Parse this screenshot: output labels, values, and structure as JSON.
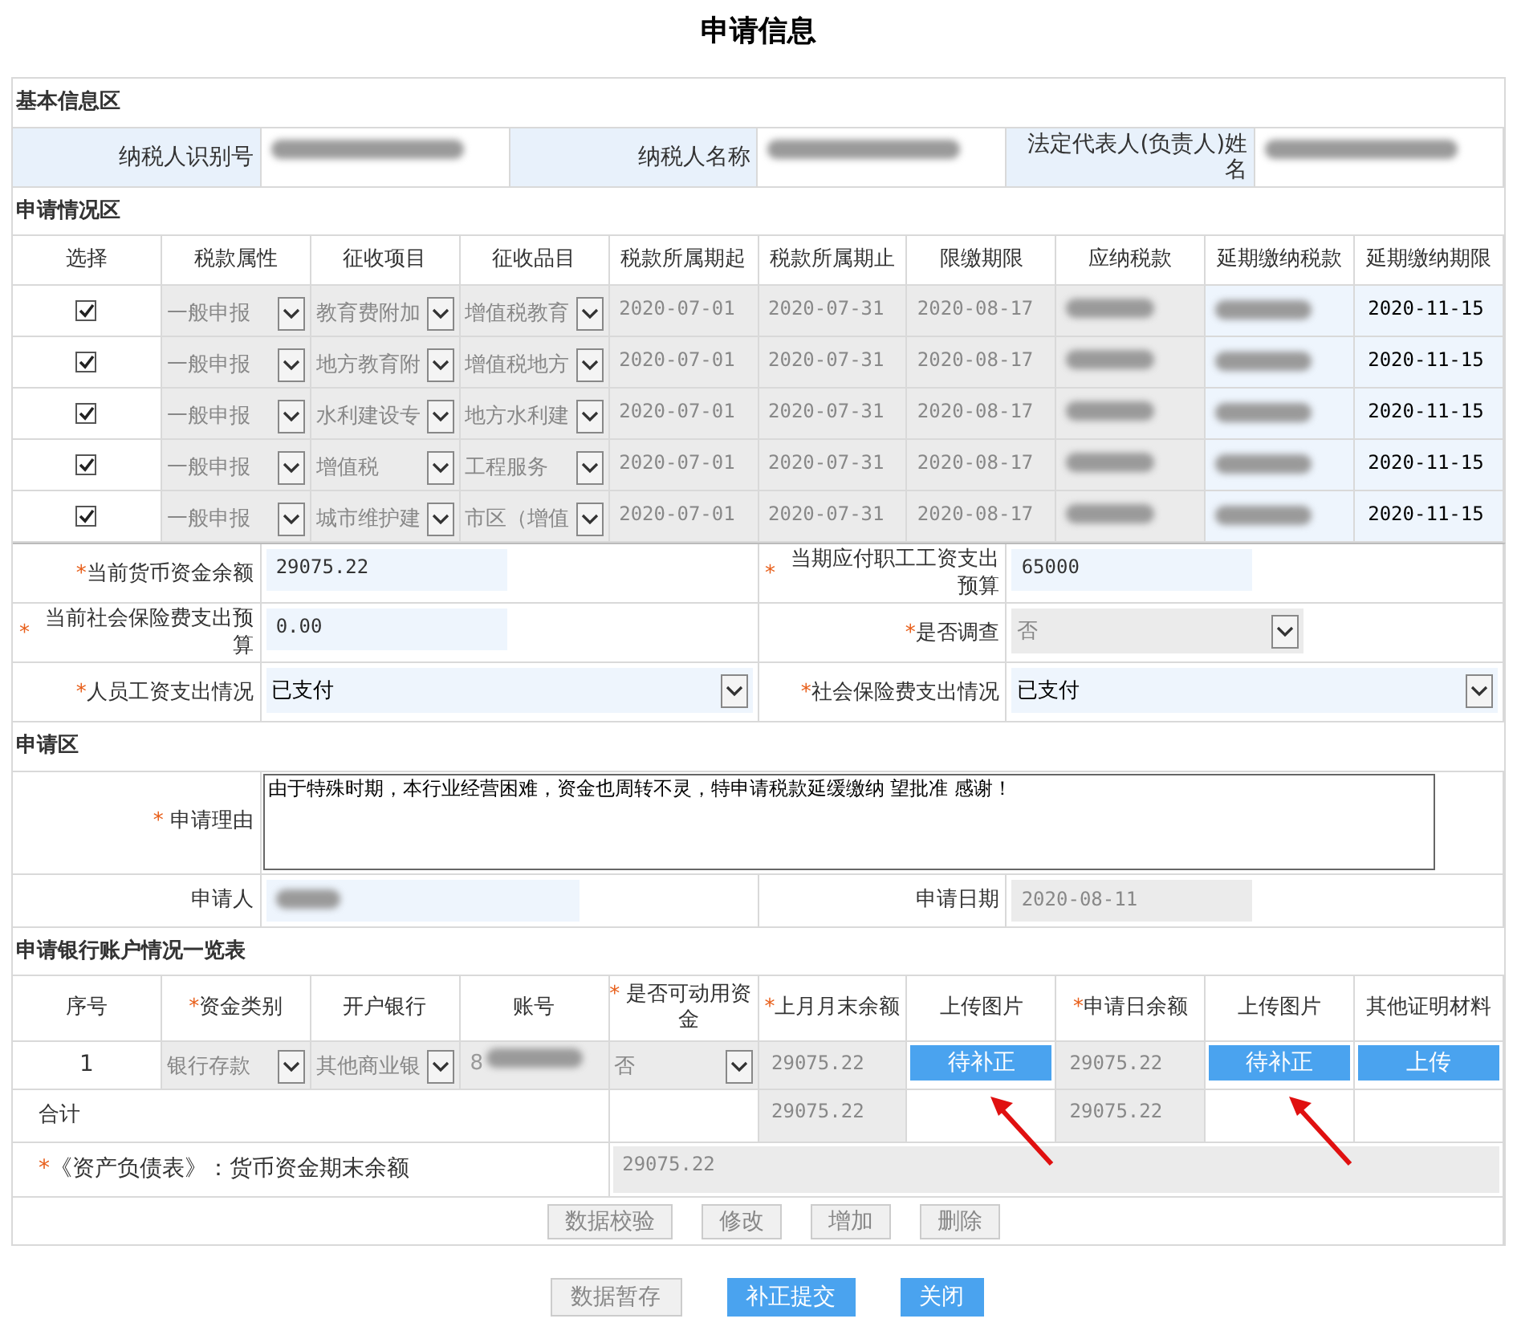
{
  "title": "申请信息",
  "basic_info": {
    "section_title": "基本信息区",
    "fields": [
      {
        "label": "纳税人识别号",
        "redacted": true
      },
      {
        "label": "纳税人名称",
        "redacted": true
      },
      {
        "label": "法定代表人(负责人)姓名",
        "redacted": true
      }
    ]
  },
  "application": {
    "section_title": "申请情况区",
    "columns": [
      "选择",
      "税款属性",
      "征收项目",
      "征收品目",
      "税款所属期起",
      "税款所属期止",
      "限缴期限",
      "应纳税款",
      "延期缴纳税款",
      "延期缴纳期限"
    ],
    "rows": [
      {
        "checked": true,
        "tax_attribute": "一般申报",
        "item": "教育费附加",
        "subitem": "增值税教育",
        "period_start": "2020-07-01",
        "period_end": "2020-07-31",
        "deadline": "2020-08-17",
        "tax_due_redacted": true,
        "deferred_tax_redacted": true,
        "deferred_deadline": "2020-11-15"
      },
      {
        "checked": true,
        "tax_attribute": "一般申报",
        "item": "地方教育附",
        "subitem": "增值税地方",
        "period_start": "2020-07-01",
        "period_end": "2020-07-31",
        "deadline": "2020-08-17",
        "tax_due_redacted": true,
        "deferred_tax_redacted": true,
        "deferred_deadline": "2020-11-15"
      },
      {
        "checked": true,
        "tax_attribute": "一般申报",
        "item": "水利建设专",
        "subitem": "地方水利建",
        "period_start": "2020-07-01",
        "period_end": "2020-07-31",
        "deadline": "2020-08-17",
        "tax_due_redacted": true,
        "deferred_tax_redacted": true,
        "deferred_deadline": "2020-11-15"
      },
      {
        "checked": true,
        "tax_attribute": "一般申报",
        "item": "增值税",
        "subitem": "工程服务",
        "period_start": "2020-07-01",
        "period_end": "2020-07-31",
        "deadline": "2020-08-17",
        "tax_due_redacted": true,
        "deferred_tax_redacted": true,
        "deferred_deadline": "2020-11-15"
      },
      {
        "checked": true,
        "tax_attribute": "一般申报",
        "item": "城市维护建",
        "subitem": "市区（增值",
        "period_start": "2020-07-01",
        "period_end": "2020-07-31",
        "deadline": "2020-08-17",
        "tax_due_redacted": true,
        "deferred_tax_redacted": true,
        "deferred_deadline": "2020-11-15"
      }
    ]
  },
  "finance_fields": [
    {
      "label": "当前货币资金余额",
      "required_mark": "*",
      "kind": "input",
      "value": "29075.22",
      "disabled": false
    },
    {
      "label": "当期应付职工工资支出预算",
      "required_mark": "*",
      "kind": "input",
      "value": "65000",
      "disabled": false
    },
    {
      "label": "当前社会保险费支出预算",
      "required_mark": "*",
      "kind": "input",
      "value": "0.00",
      "disabled": false
    },
    {
      "label": "是否调查",
      "required_mark": "*",
      "kind": "select",
      "value": "否",
      "disabled": true
    },
    {
      "label": "人员工资支出情况",
      "required_mark": "*",
      "kind": "select",
      "value": "已支付",
      "disabled": false
    },
    {
      "label": "社会保险费支出情况",
      "required_mark": "*",
      "kind": "select",
      "value": "已支付",
      "disabled": false
    }
  ],
  "request": {
    "section_title": "申请区",
    "reason_required_mark": "*",
    "reason_label": "申请理由",
    "reason": "由于特殊时期，本行业经营困难，资金也周转不灵，特申请税款延缓缴纳 望批准 感谢！",
    "applicant_label": "申请人",
    "applicant_redacted": true,
    "date_label": "申请日期",
    "date": "2020-08-11"
  },
  "bank": {
    "section_title": "申请银行账户情况一览表",
    "columns": [
      {
        "label": "序号"
      },
      {
        "label": "资金类别",
        "required_mark": "*"
      },
      {
        "label": "开户银行"
      },
      {
        "label": "账号"
      },
      {
        "label": "是否可动用资金",
        "required_mark": "*"
      },
      {
        "label": "上月月末余额",
        "required_mark": "*"
      },
      {
        "label": "上传图片"
      },
      {
        "label": "申请日余额",
        "required_mark": "*"
      },
      {
        "label": "上传图片"
      },
      {
        "label": "其他证明材料"
      }
    ],
    "rows": [
      {
        "index": "1",
        "fund_type": "银行存款",
        "bank": "其他商业银",
        "account_visible": "8",
        "usable": "否",
        "prev_balance": "29075.22",
        "upload_1": {
          "label": "待补正",
          "pointed": true
        },
        "day_balance": "29075.22",
        "upload_2": {
          "label": "待补正",
          "pointed": true
        },
        "other": {
          "label": "上传"
        }
      }
    ],
    "total_label": "合计",
    "total_prev": "29075.22",
    "total_day": "29075.22",
    "balance_sheet_label": "《资产负债表》：货币资金期末余额",
    "balance_sheet_required_mark": "*",
    "balance_sheet_value": "29075.22",
    "actions": [
      "数据校验",
      "修改",
      "增加",
      "删除"
    ]
  },
  "footer_buttons": [
    {
      "label": "数据暂存",
      "primary": false
    },
    {
      "label": "补正提交",
      "primary": true
    },
    {
      "label": "关闭",
      "primary": true
    }
  ]
}
